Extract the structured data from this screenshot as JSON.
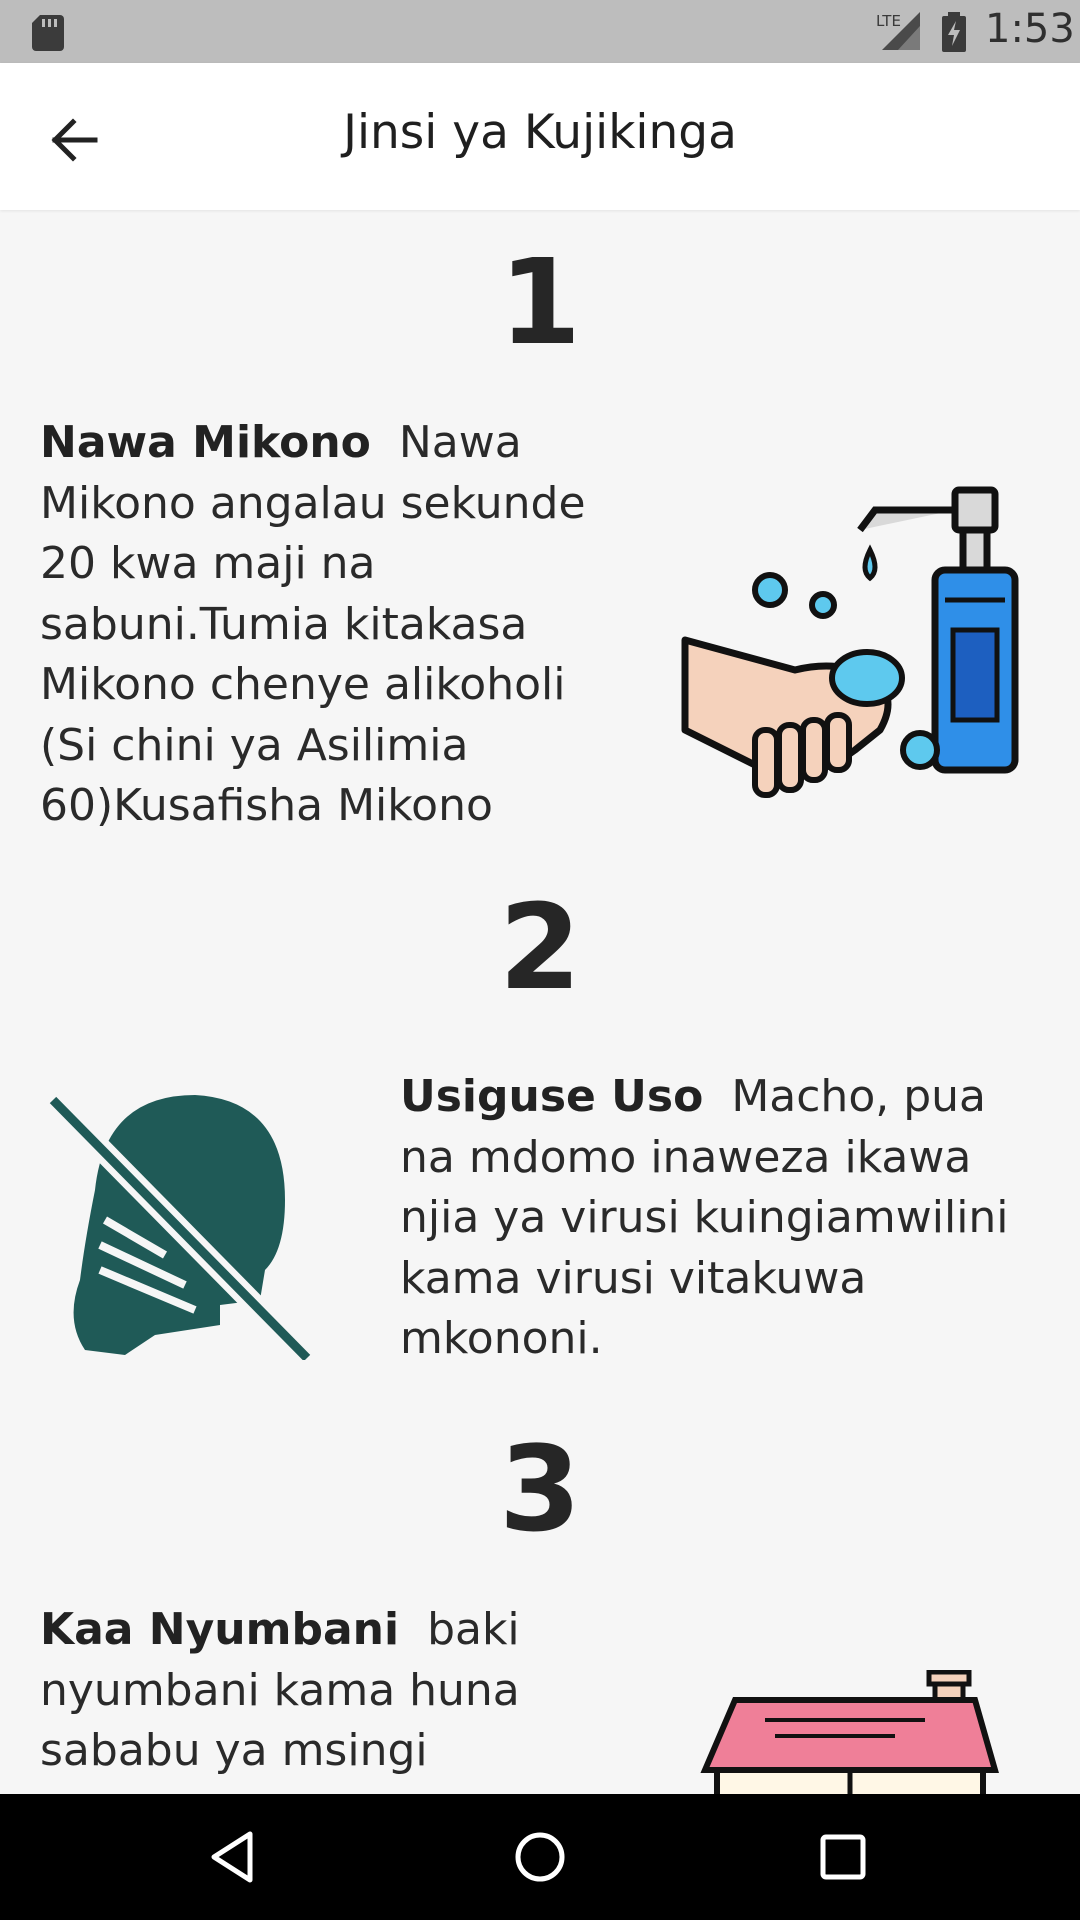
{
  "status_bar": {
    "time": "1:53",
    "network": "LTE"
  },
  "app_bar": {
    "title": "Jinsi ya Kujikinga",
    "back_icon": "arrow-back-icon"
  },
  "steps": [
    {
      "number": "1",
      "heading": "Nawa Mikono",
      "body": "Nawa Mikono angalau sekunde 20 kwa maji na sabuni.Tumia kitakasa Mikono chenye alikoholi (Si chini ya Asilimia 60)Kusafisha Mikono",
      "image": "hand-washing-icon"
    },
    {
      "number": "2",
      "heading": "Usiguse Uso",
      "body": "Macho, pua na mdomo inaweza ikawa njia ya virusi kuingiamwilini kama virusi vitakuwa mkononi.",
      "image": "no-face-touching-icon"
    },
    {
      "number": "3",
      "heading": "Kaa Nyumbani",
      "body": "baki nyumbani kama huna sababu ya msingi",
      "image": "house-icon"
    }
  ],
  "nav_bar": {
    "back": "nav-back-icon",
    "home": "nav-home-icon",
    "recents": "nav-recents-icon"
  },
  "colors": {
    "status_bar": "#bdbdbd",
    "background": "#f6f6f6",
    "no_touch_icon": "#1f5a57",
    "soap_blue": "#2f8fe8",
    "roof_pink": "#ef7f98"
  }
}
